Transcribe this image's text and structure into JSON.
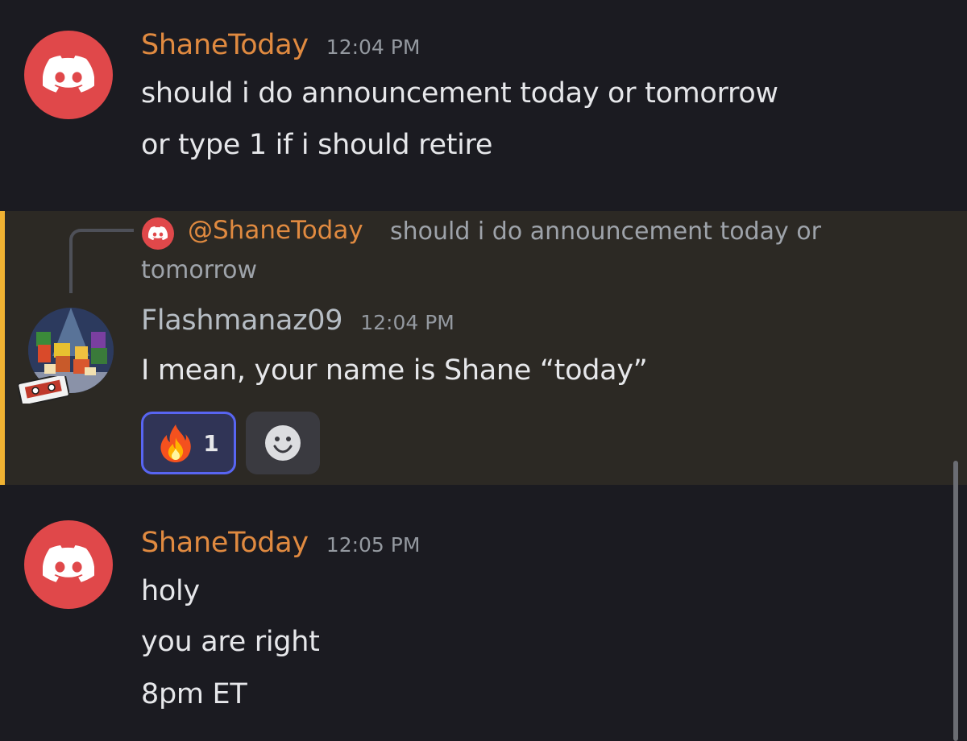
{
  "messages": [
    {
      "author": "ShaneToday",
      "timestamp": "12:04 PM",
      "avatar_icon": "discord-logo-icon",
      "lines": [
        "should i do announcement today or tomorrow",
        "or type 1 if i should retire"
      ]
    },
    {
      "reply": {
        "mention": "@ShaneToday",
        "text_line1": "should i do announcement today or",
        "text_line2": "tomorrow"
      },
      "author": "Flashmanaz09",
      "timestamp": "12:04 PM",
      "avatar_icon": "pixel-art-avatar",
      "lines": [
        "I mean, your name is Shane “today”"
      ],
      "reactions": [
        {
          "emoji": "🔥",
          "count": "1",
          "icon": "fire-icon"
        }
      ],
      "add_reaction_icon": "smiley-icon"
    },
    {
      "author": "ShaneToday",
      "timestamp": "12:05 PM",
      "avatar_icon": "discord-logo-icon",
      "lines": [
        "holy",
        "you are right",
        "8pm ET"
      ]
    }
  ],
  "colors": {
    "background": "#1b1b21",
    "mention_highlight": "#2c2924",
    "mention_bar": "#f0b232",
    "author_orange": "#e08a40",
    "avatar_red": "#e0484a",
    "reaction_accent": "#5865f2"
  }
}
